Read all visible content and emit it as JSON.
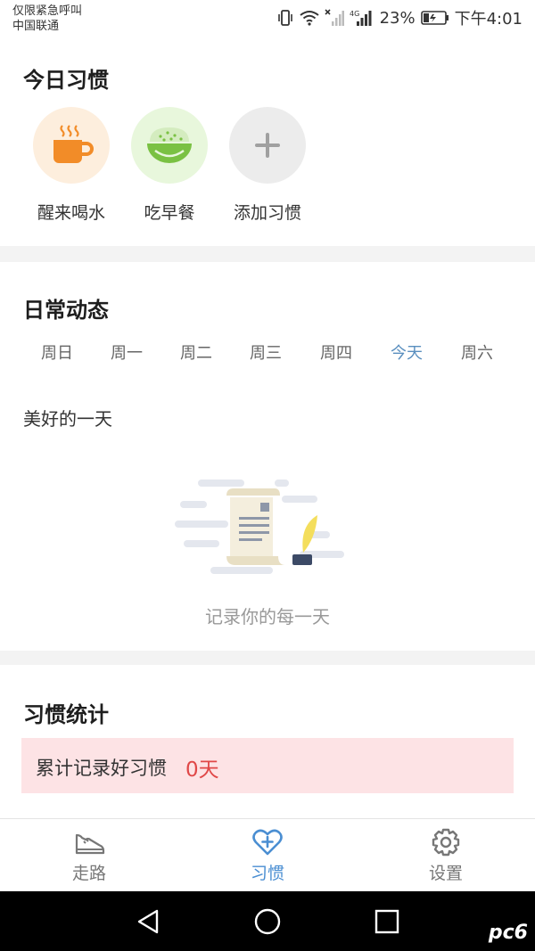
{
  "status_bar": {
    "carrier_line1": "仅限紧急呼叫",
    "carrier_line2": "中国联通",
    "network": "4G",
    "battery": "23%",
    "time": "下午4:01"
  },
  "today_habits": {
    "title": "今日习惯",
    "items": [
      {
        "label": "醒来喝水",
        "icon": "coffee-cup-icon",
        "color": "#f28c28",
        "bg": "#fdeedd"
      },
      {
        "label": "吃早餐",
        "icon": "rice-bowl-icon",
        "color": "#7ac143",
        "bg": "#e8f7dc"
      },
      {
        "label": "添加习惯",
        "icon": "plus-icon",
        "color": "#999999",
        "bg": "#ececec"
      }
    ]
  },
  "daily": {
    "title": "日常动态",
    "week": [
      "周日",
      "周一",
      "周二",
      "周三",
      "周四",
      "今天",
      "周六"
    ],
    "active_index": 5,
    "subtitle": "美好的一天",
    "empty_text": "记录你的每一天",
    "empty_icon": "scroll-quill-icon"
  },
  "stats": {
    "title": "习惯统计",
    "label": "累计记录好习惯",
    "value": "0天"
  },
  "tab_bar": {
    "tabs": [
      {
        "label": "走路",
        "icon": "shoe-icon"
      },
      {
        "label": "习惯",
        "icon": "heart-plus-icon"
      },
      {
        "label": "设置",
        "icon": "gear-icon"
      }
    ],
    "active_index": 1
  },
  "nav": {
    "back": "back-triangle-icon",
    "home": "home-circle-icon",
    "recent": "recent-square-icon",
    "watermark": "pc6"
  },
  "colors": {
    "accent": "#4a8ed2",
    "stat_bg": "#fde3e5",
    "stat_value": "#e04848"
  }
}
